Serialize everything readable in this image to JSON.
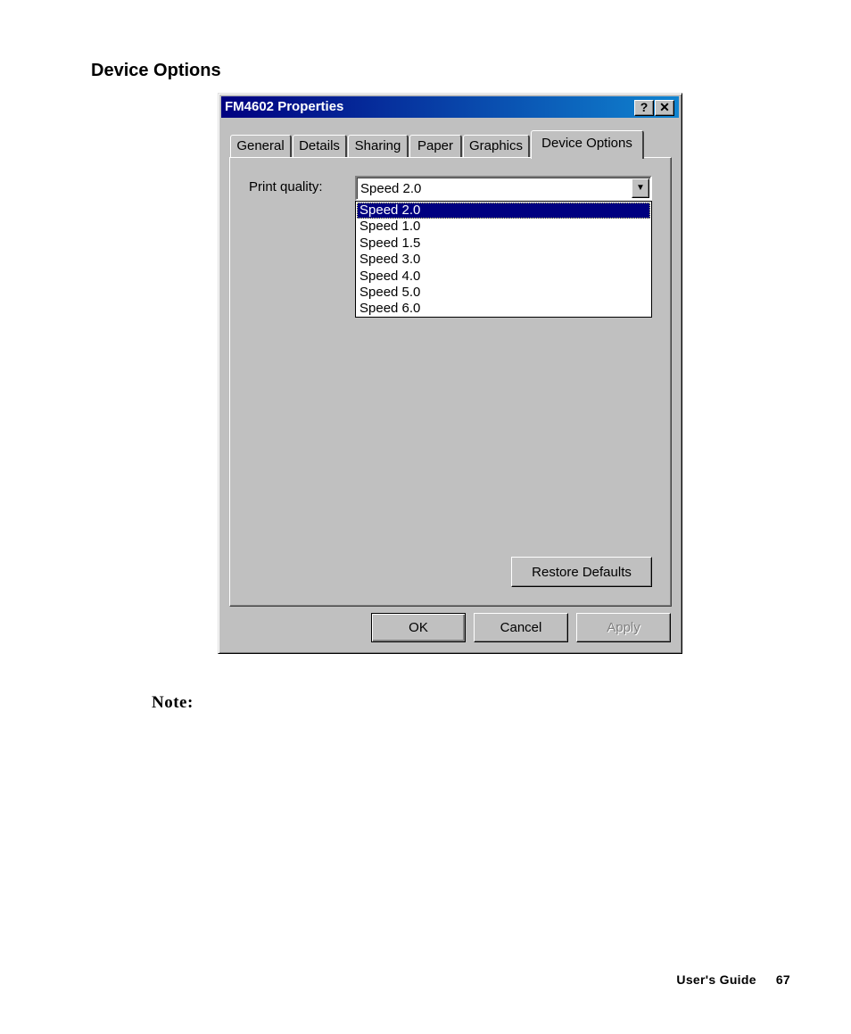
{
  "heading": "Device Options",
  "dialog": {
    "title": "FM4602 Properties",
    "help_glyph": "?",
    "close_glyph": "✕",
    "tabs": [
      {
        "label": "General"
      },
      {
        "label": "Details"
      },
      {
        "label": "Sharing"
      },
      {
        "label": "Paper"
      },
      {
        "label": "Graphics"
      },
      {
        "label": "Device Options",
        "active": true
      }
    ],
    "print_quality": {
      "label": "Print quality:",
      "value": "Speed 2.0",
      "arrow_icon": "chevron-down-icon",
      "options": [
        "Speed 2.0",
        "Speed 1.0",
        "Speed 1.5",
        "Speed 3.0",
        "Speed 4.0",
        "Speed 5.0",
        "Speed 6.0"
      ],
      "selected_index": 0
    },
    "buttons": {
      "restore_defaults": "Restore Defaults",
      "ok": "OK",
      "cancel": "Cancel",
      "apply": "Apply"
    }
  },
  "note_label": "Note:",
  "footer": {
    "guide": "User's Guide",
    "page": "67"
  }
}
